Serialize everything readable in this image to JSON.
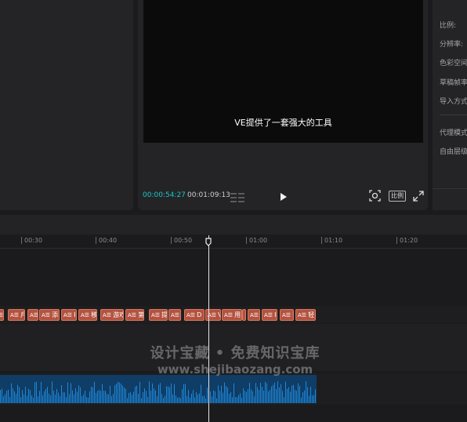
{
  "player": {
    "subtitle_text": "VE提供了一套强大的工具",
    "current_time": "00:00:54:27",
    "total_time": "00:01:09:13",
    "ratio_label": "比例",
    "accent_color": "#1ec6c8"
  },
  "properties": {
    "labels": [
      "比例:",
      "分辨率:",
      "色彩空间",
      "草稿帧率",
      "导入方式",
      "代理模式",
      "自由层级"
    ]
  },
  "timeline": {
    "ruler_ticks": [
      "00:30",
      "00:40",
      "00:50",
      "01:00",
      "01:10",
      "01:20"
    ],
    "subtitle_clips": [
      {
        "icon": "A☰",
        "text": ""
      },
      {
        "icon": "A☰",
        "text": "戶"
      },
      {
        "icon": "A☰",
        "text": "I"
      },
      {
        "icon": "A☰",
        "text": "添"
      },
      {
        "icon": "A☰",
        "text": "I"
      },
      {
        "icon": "A☰",
        "text": "移"
      },
      {
        "icon": "A☰",
        "text": "游戏"
      },
      {
        "icon": "A☰",
        "text": "第"
      },
      {
        "icon": "A☰",
        "text": "提"
      },
      {
        "icon": "A☰",
        "text": ""
      },
      {
        "icon": "A☰",
        "text": "D"
      },
      {
        "icon": "A☰",
        "text": "V"
      },
      {
        "icon": "A☰",
        "text": "用"
      },
      {
        "icon": "",
        "text": ""
      },
      {
        "icon": "A☰",
        "text": ""
      },
      {
        "icon": "A☰",
        "text": "I"
      },
      {
        "icon": "A☰",
        "text": "I"
      },
      {
        "icon": "A☰",
        "text": "轻"
      }
    ],
    "audio_color": "#1f88d8"
  },
  "watermark": {
    "line1": "设计宝藏 • 免费知识宝库",
    "line2": "www.shejibaozang.com"
  },
  "icons": {
    "play": "play-icon",
    "scope": "scope-icon",
    "fullscreen": "fullscreen-icon",
    "grid": "grid-icon"
  }
}
